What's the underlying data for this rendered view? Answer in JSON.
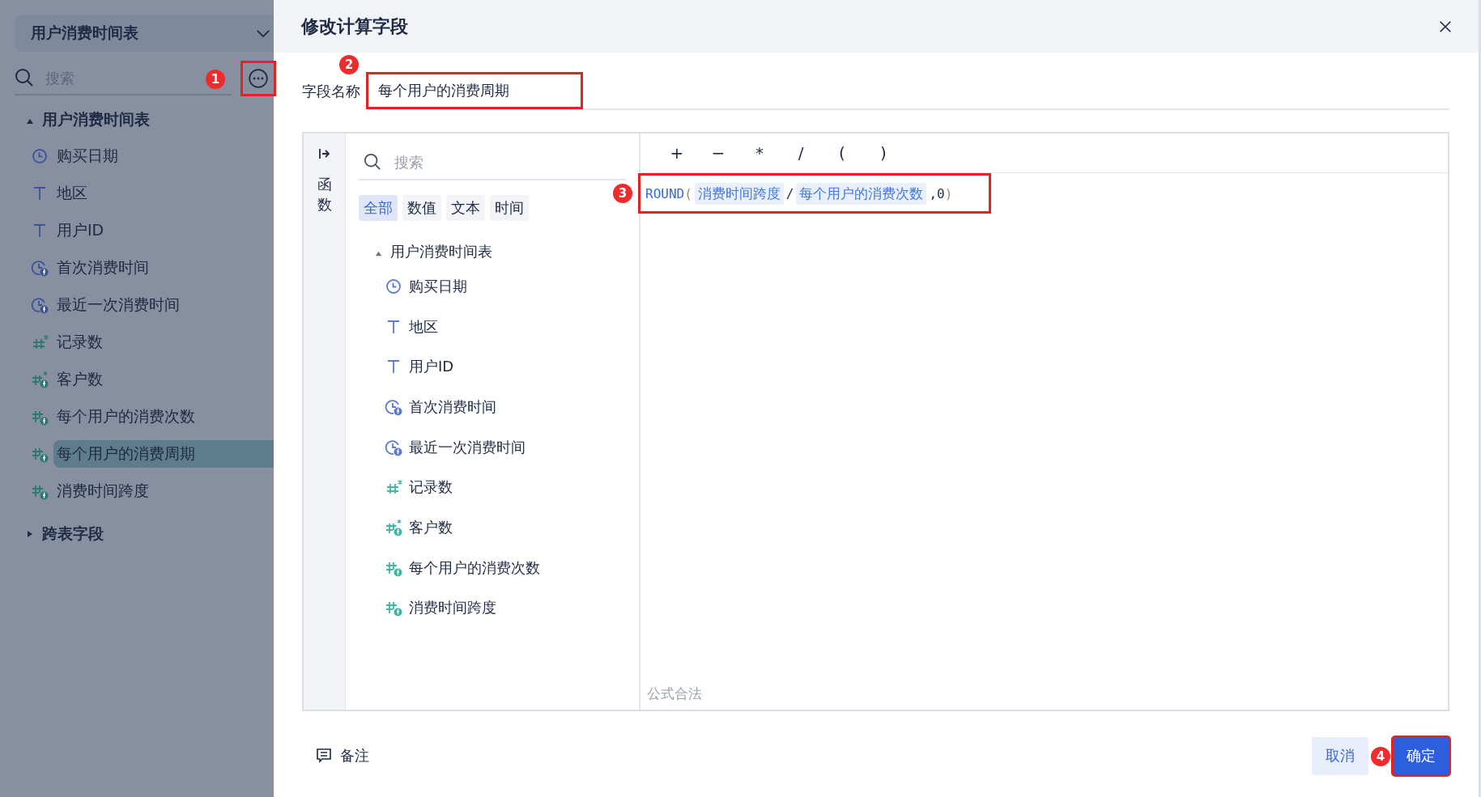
{
  "sidebar": {
    "table_select": "用户消费时间表",
    "search": {
      "placeholder": "搜索"
    },
    "more_button": {
      "marker": "1"
    },
    "tree": [
      {
        "label": "用户消费时间表",
        "expanded": true,
        "children": [
          {
            "label": "购买日期",
            "kind": "date",
            "selected": false
          },
          {
            "label": "地区",
            "kind": "text",
            "selected": false
          },
          {
            "label": "用户ID",
            "kind": "text",
            "selected": false
          },
          {
            "label": "首次消费时间",
            "kind": "date_calc",
            "selected": false
          },
          {
            "label": "最近一次消费时间",
            "kind": "date_calc",
            "selected": false
          },
          {
            "label": "记录数",
            "kind": "count",
            "selected": false
          },
          {
            "label": "客户数",
            "kind": "count_calc",
            "selected": false
          },
          {
            "label": "每个用户的消费次数",
            "kind": "number_calc",
            "selected": false
          },
          {
            "label": "每个用户的消费周期",
            "kind": "number_calc",
            "selected": true
          },
          {
            "label": "消费时间跨度",
            "kind": "number_calc",
            "selected": false
          }
        ]
      },
      {
        "label": "跨表字段",
        "expanded": false
      }
    ]
  },
  "dialog": {
    "title": "修改计算字段",
    "name_field": {
      "label": "字段名称",
      "value": "每个用户的消费周期",
      "marker": "2"
    },
    "function_tab": "函数",
    "field_search": {
      "placeholder": "搜索"
    },
    "filters": [
      {
        "label": "全部",
        "selected": true
      },
      {
        "label": "数值",
        "selected": false
      },
      {
        "label": "文本",
        "selected": false
      },
      {
        "label": "时间",
        "selected": false
      }
    ],
    "field_tree": [
      {
        "label": "用户消费时间表",
        "expanded": true,
        "children": [
          {
            "label": "购买日期",
            "kind": "date"
          },
          {
            "label": "地区",
            "kind": "text"
          },
          {
            "label": "用户ID",
            "kind": "text"
          },
          {
            "label": "首次消费时间",
            "kind": "date_calc"
          },
          {
            "label": "最近一次消费时间",
            "kind": "date_calc"
          },
          {
            "label": "记录数",
            "kind": "count"
          },
          {
            "label": "客户数",
            "kind": "count_calc"
          },
          {
            "label": "每个用户的消费次数",
            "kind": "number_calc"
          },
          {
            "label": "消费时间跨度",
            "kind": "number_calc"
          }
        ]
      }
    ],
    "operators": [
      "+",
      "−",
      "*",
      "/",
      "(",
      ")"
    ],
    "formula": {
      "marker": "3",
      "tokens": [
        {
          "kind": "func",
          "text": "ROUND"
        },
        {
          "kind": "paren",
          "text": "("
        },
        {
          "kind": "field",
          "text": "消费时间跨度"
        },
        {
          "kind": "op",
          "text": "/"
        },
        {
          "kind": "field",
          "text": "每个用户的消费次数"
        },
        {
          "kind": "op",
          "text": ",0"
        },
        {
          "kind": "paren",
          "text": ")"
        }
      ]
    },
    "status": "公式合法",
    "note_button": "备注",
    "buttons": [
      {
        "label": "取消",
        "kind": "secondary"
      },
      {
        "label": "确定",
        "kind": "primary",
        "marker": "4"
      }
    ]
  }
}
